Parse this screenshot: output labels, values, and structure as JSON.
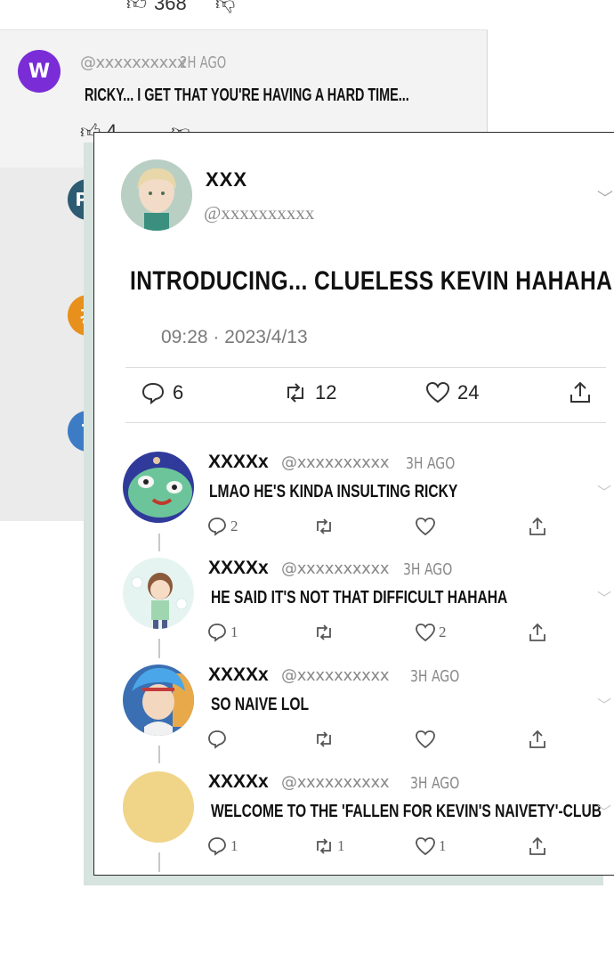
{
  "background": {
    "top_like_count": "368",
    "comment": {
      "avatar_letter": "W",
      "handle": "@xxxxxxxxxx",
      "time": "2H AGO",
      "text": "RICKY... I GET THAT YOU'RE HAVING A HARD TIME...",
      "like_count": "4"
    },
    "side_avatars": [
      "PC",
      "강",
      "T"
    ]
  },
  "tweet": {
    "name": "XXX",
    "handle": "@xxxxxxxxxx",
    "text": "INTRODUCING... CLUELESS KEVIN HAHAHA",
    "datetime": "09:28 · 2023/4/13",
    "replies": "6",
    "retweets": "12",
    "likes": "24"
  },
  "replies": [
    {
      "name": "XXXXx",
      "handle": "@xxxxxxxxxx",
      "time": "3H AGO",
      "text": "LMAO HE'S KINDA INSULTING RICKY",
      "reply_count": "2",
      "retweet_count": "",
      "like_count": ""
    },
    {
      "name": "XXXXx",
      "handle": "@xxxxxxxxxx",
      "time": "3H AGO",
      "text": "HE SAID IT'S NOT THAT DIFFICULT HAHAHA",
      "reply_count": "1",
      "retweet_count": "",
      "like_count": "2"
    },
    {
      "name": "XXXXx",
      "handle": "@xxxxxxxxxx",
      "time": "3H AGO",
      "text": "SO NAIVE LOL",
      "reply_count": "",
      "retweet_count": "",
      "like_count": ""
    },
    {
      "name": "XXXXx",
      "handle": "@xxxxxxxxxx",
      "time": "3H AGO",
      "text": "WELCOME TO THE 'FALLEN FOR KEVIN'S NAIVETY'-CLUB",
      "reply_count": "1",
      "retweet_count": "1",
      "like_count": "1"
    }
  ],
  "colors": {
    "avatar_w": "#7a2dd6",
    "avatar_pc": "#2c5b72",
    "avatar_k": "#e8901c",
    "avatar_t": "#3d7cc5",
    "avatar_yellow": "#f0d488",
    "shadow_frame": "#d6e3df"
  },
  "icons": [
    "thumbs-up-icon",
    "thumbs-down-icon",
    "reply-icon",
    "retweet-icon",
    "heart-icon",
    "share-icon",
    "chevron-down-icon"
  ]
}
